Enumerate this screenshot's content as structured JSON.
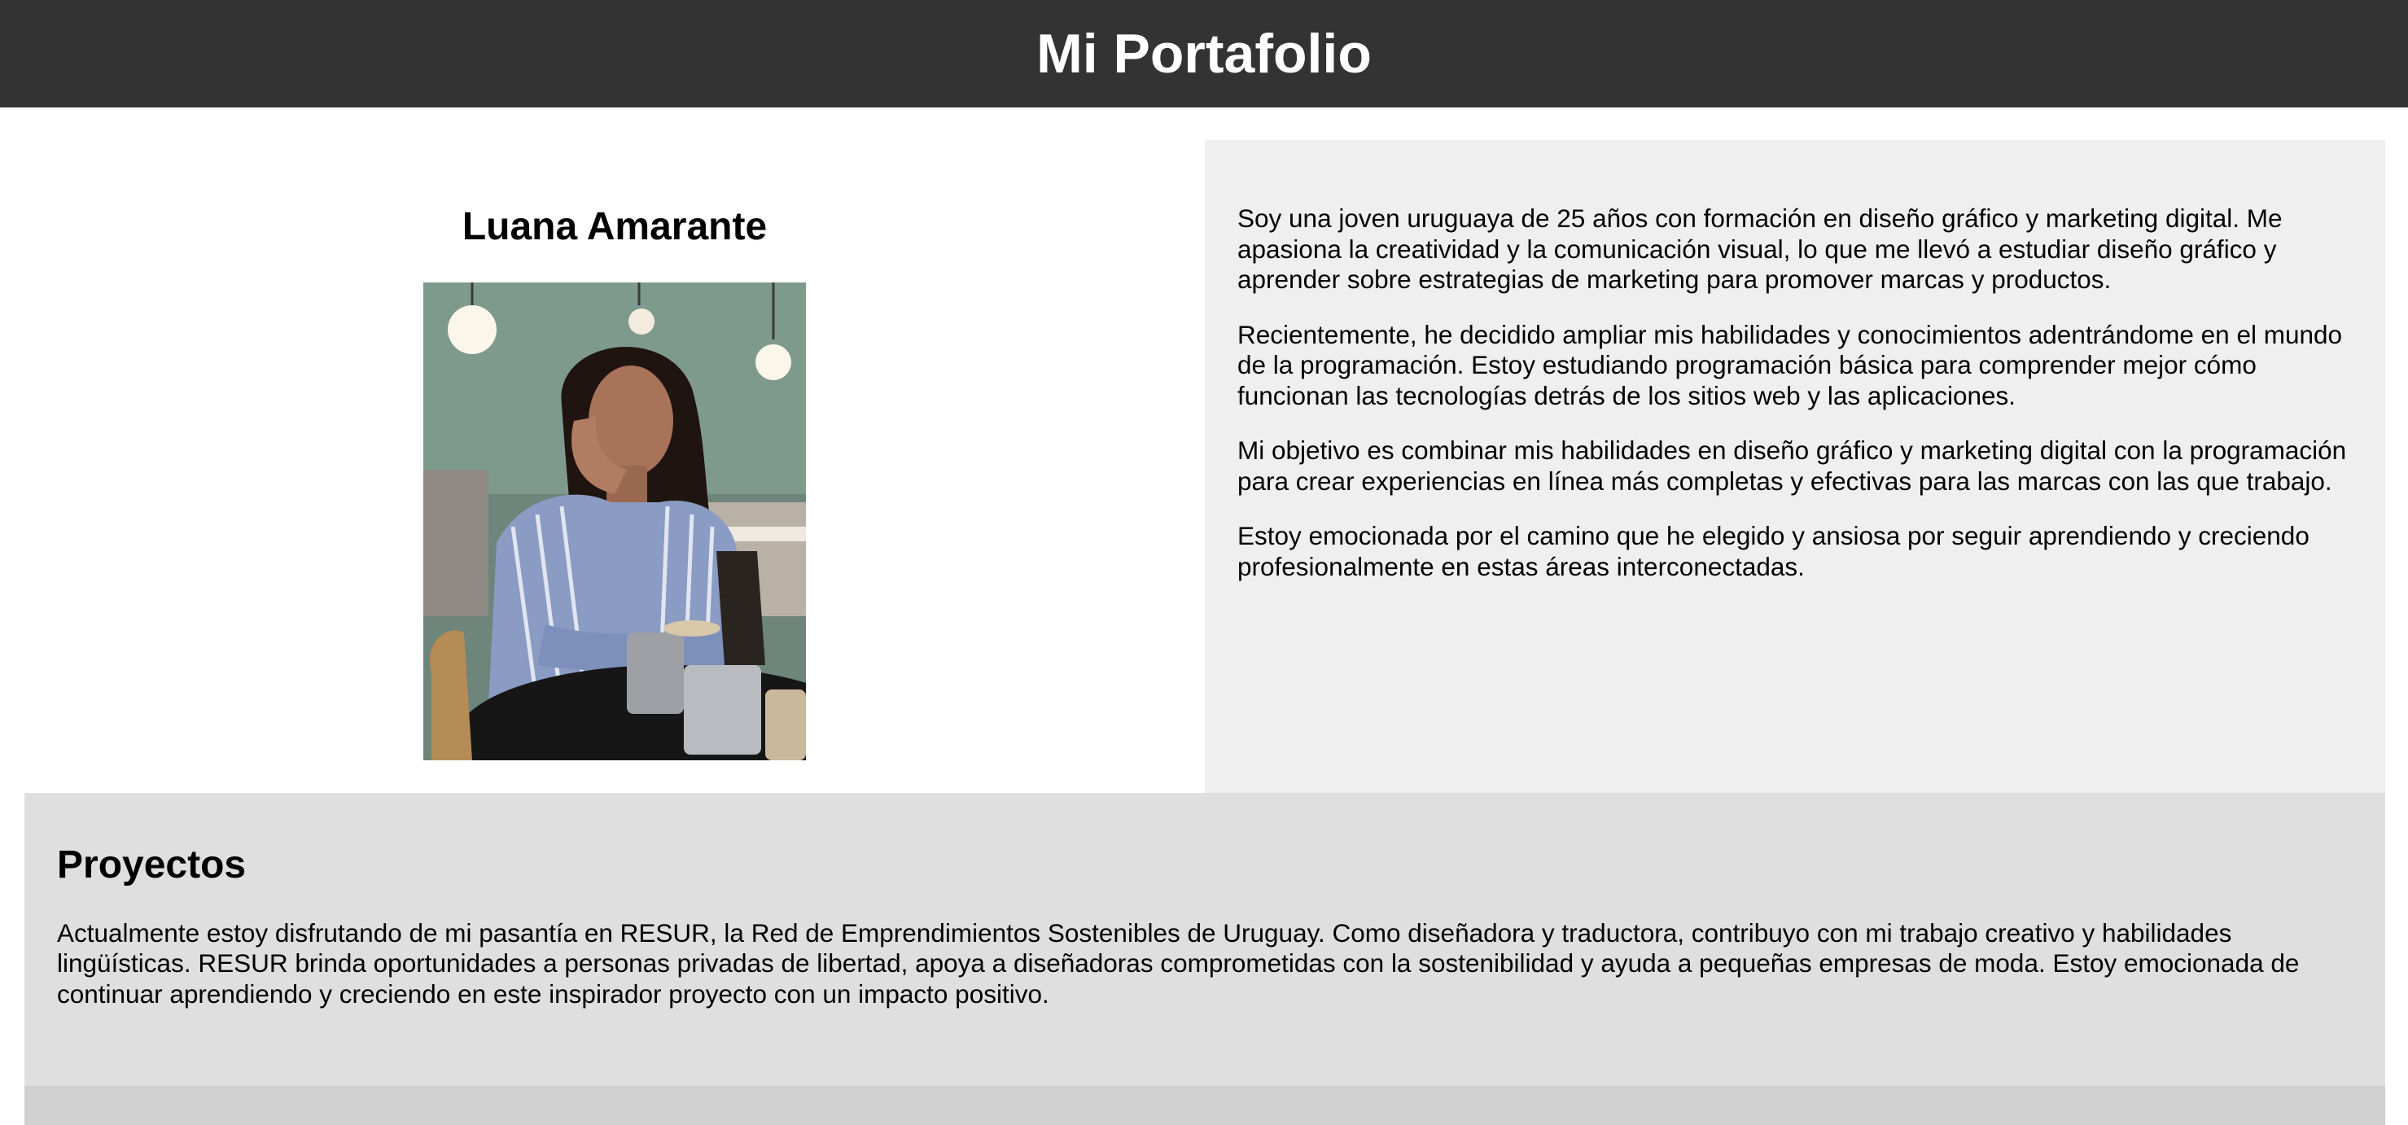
{
  "header": {
    "title": "Mi Portafolio"
  },
  "profile": {
    "name": "Luana Amarante",
    "photo_icon": "profile-photo"
  },
  "about": {
    "paragraphs": [
      "Soy una joven uruguaya de 25 años con formación en diseño gráfico y marketing digital. Me apasiona la creatividad y la comunicación visual, lo que me llevó a estudiar diseño gráfico y aprender sobre estrategias de marketing para promover marcas y productos.",
      "Recientemente, he decidido ampliar mis habilidades y conocimientos adentrándome en el mundo de la programación. Estoy estudiando programación básica para comprender mejor cómo funcionan las tecnologías detrás de los sitios web y las aplicaciones.",
      "Mi objetivo es combinar mis habilidades en diseño gráfico y marketing digital con la programación para crear experiencias en línea más completas y efectivas para las marcas con las que trabajo.",
      "Estoy emocionada por el camino que he elegido y ansiosa por seguir aprendiendo y creciendo profesionalmente en estas áreas interconectadas."
    ]
  },
  "projects": {
    "title": "Proyectos",
    "text": "Actualmente estoy disfrutando de mi pasantía en RESUR, la Red de Emprendimientos Sostenibles de Uruguay. Como diseñadora y traductora, contribuyo con mi trabajo creativo y habilidades lingüísticas. RESUR brinda oportunidades a personas privadas de libertad, apoya a diseñadoras comprometidas con la sostenibilidad y ayuda a pequeñas empresas de moda. Estoy emocionada de continuar aprendiendo y creciendo en este inspirador proyecto con un impacto positivo."
  },
  "colors": {
    "header_bg": "#333333",
    "about_bg": "#efefef",
    "projects_bg": "#dfdfdf",
    "footer_strip": "#d0d0d0"
  }
}
